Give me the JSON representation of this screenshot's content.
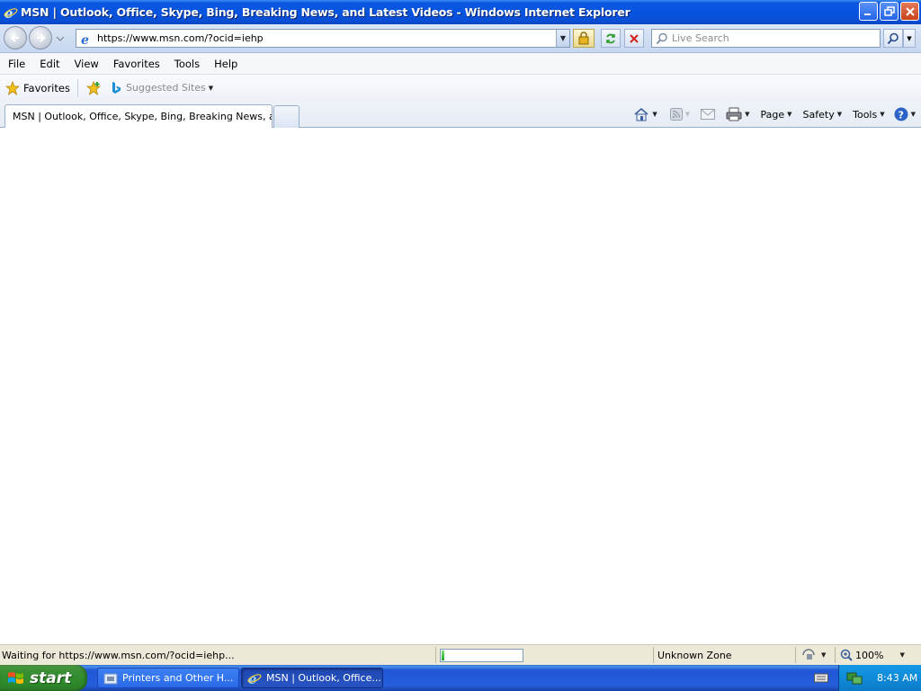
{
  "window": {
    "title": "MSN | Outlook, Office, Skype, Bing, Breaking News, and Latest Videos - Windows Internet Explorer",
    "minimize": "minimize-icon",
    "restore": "restore-icon",
    "close": "close-icon"
  },
  "address_bar": {
    "url": "https://www.msn.com/?ocid=iehp",
    "search_placeholder": "Live Search"
  },
  "menu": [
    "File",
    "Edit",
    "View",
    "Favorites",
    "Tools",
    "Help"
  ],
  "favorites_bar": {
    "favorites_label": "Favorites",
    "suggested_sites_label": "Suggested Sites"
  },
  "tabs": [
    {
      "label": "MSN | Outlook, Office, Skype, Bing, Breaking News, a..."
    }
  ],
  "command_bar": {
    "page_label": "Page",
    "safety_label": "Safety",
    "tools_label": "Tools"
  },
  "status_bar": {
    "status_text": "Waiting for https://www.msn.com/?ocid=iehp...",
    "progress_fraction": 0.06,
    "zone": "Unknown Zone",
    "zoom": "100%"
  },
  "taskbar": {
    "start_label": "start",
    "tasks": [
      {
        "label": "Printers and Other H...",
        "active": false
      },
      {
        "label": "MSN | Outlook, Office...",
        "active": true
      }
    ],
    "clock": "8:43 AM"
  },
  "colors": {
    "titlebar": "#0754e0",
    "taskbar": "#245edb",
    "start": "#2e8a2b",
    "tray": "#0f8ad8"
  }
}
